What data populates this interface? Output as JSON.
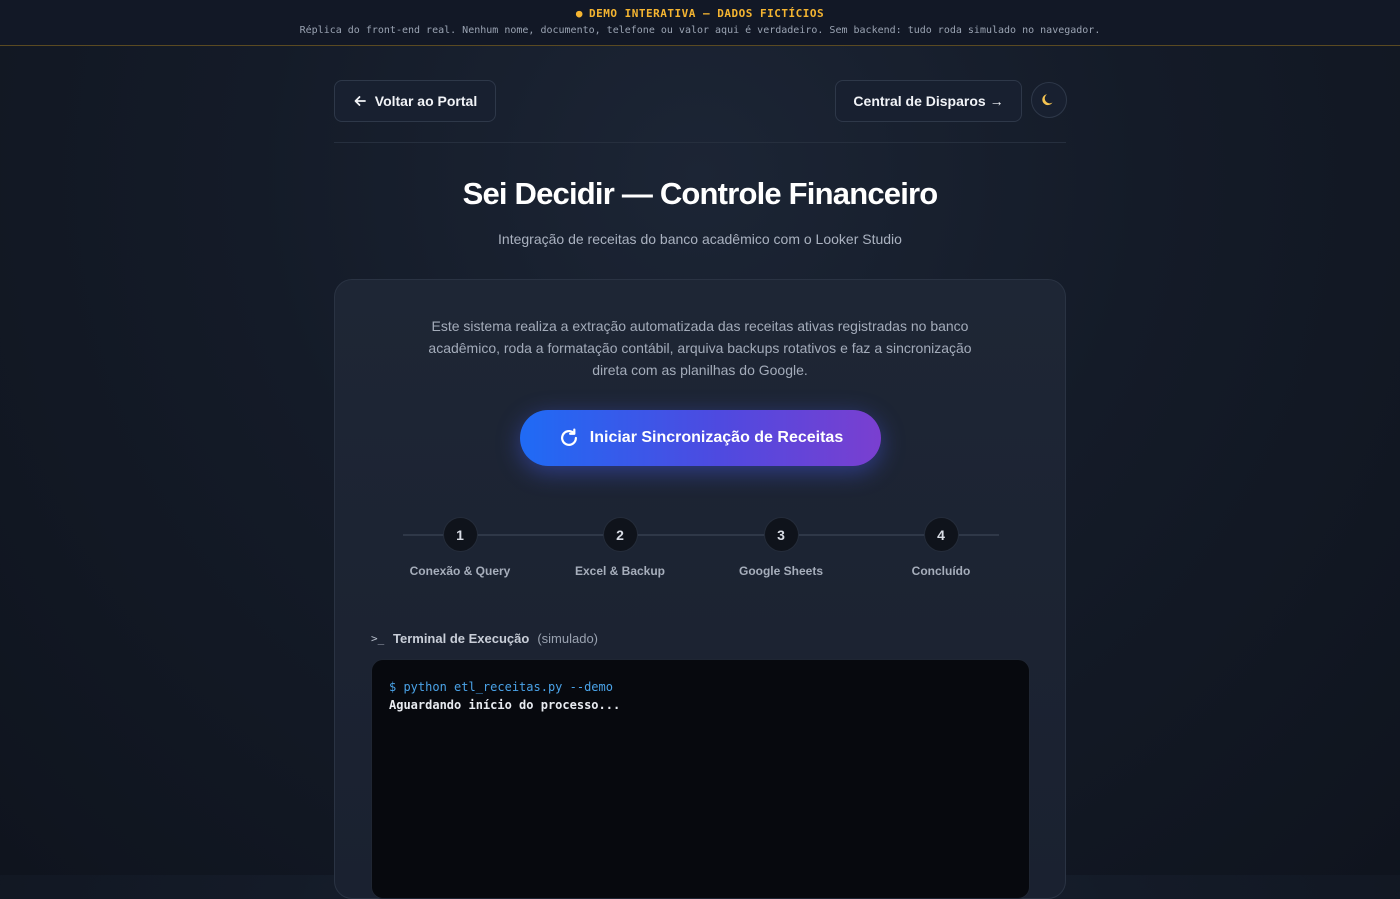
{
  "banner": {
    "title": "DEMO INTERATIVA — DADOS FICTÍCIOS",
    "dot": "●",
    "subtitle": "Réplica do front-end real. Nenhum nome, documento, telefone ou valor aqui é verdadeiro. Sem backend: tudo roda simulado no navegador."
  },
  "nav": {
    "back_label": "Voltar ao Portal",
    "central_label": "Central de Disparos →",
    "theme_icon": "moon-icon"
  },
  "header": {
    "title": "Sei Decidir — Controle Financeiro",
    "subtitle": "Integração de receitas do banco acadêmico com o Looker Studio"
  },
  "card": {
    "description": "Este sistema realiza a extração automatizada das receitas ativas registradas no banco acadêmico, roda a formatação contábil, arquiva backups rotativos e faz a sincronização direta com as planilhas do Google.",
    "primary_button": "Iniciar Sincronização de Receitas",
    "steps": [
      {
        "number": "1",
        "label": "Conexão & Query"
      },
      {
        "number": "2",
        "label": "Excel & Backup"
      },
      {
        "number": "3",
        "label": "Google Sheets"
      },
      {
        "number": "4",
        "label": "Concluído"
      }
    ],
    "terminal": {
      "icon": ">_",
      "title": "Terminal de Execução",
      "note": "(simulado)",
      "command": "$ python etl_receitas.py --demo",
      "status": "Aguardando início do processo..."
    }
  },
  "colors": {
    "accent_start": "#1f6bf5",
    "accent_end": "#7a3fd0",
    "banner_text": "#f5b531",
    "terminal_command": "#4aa3e8"
  }
}
